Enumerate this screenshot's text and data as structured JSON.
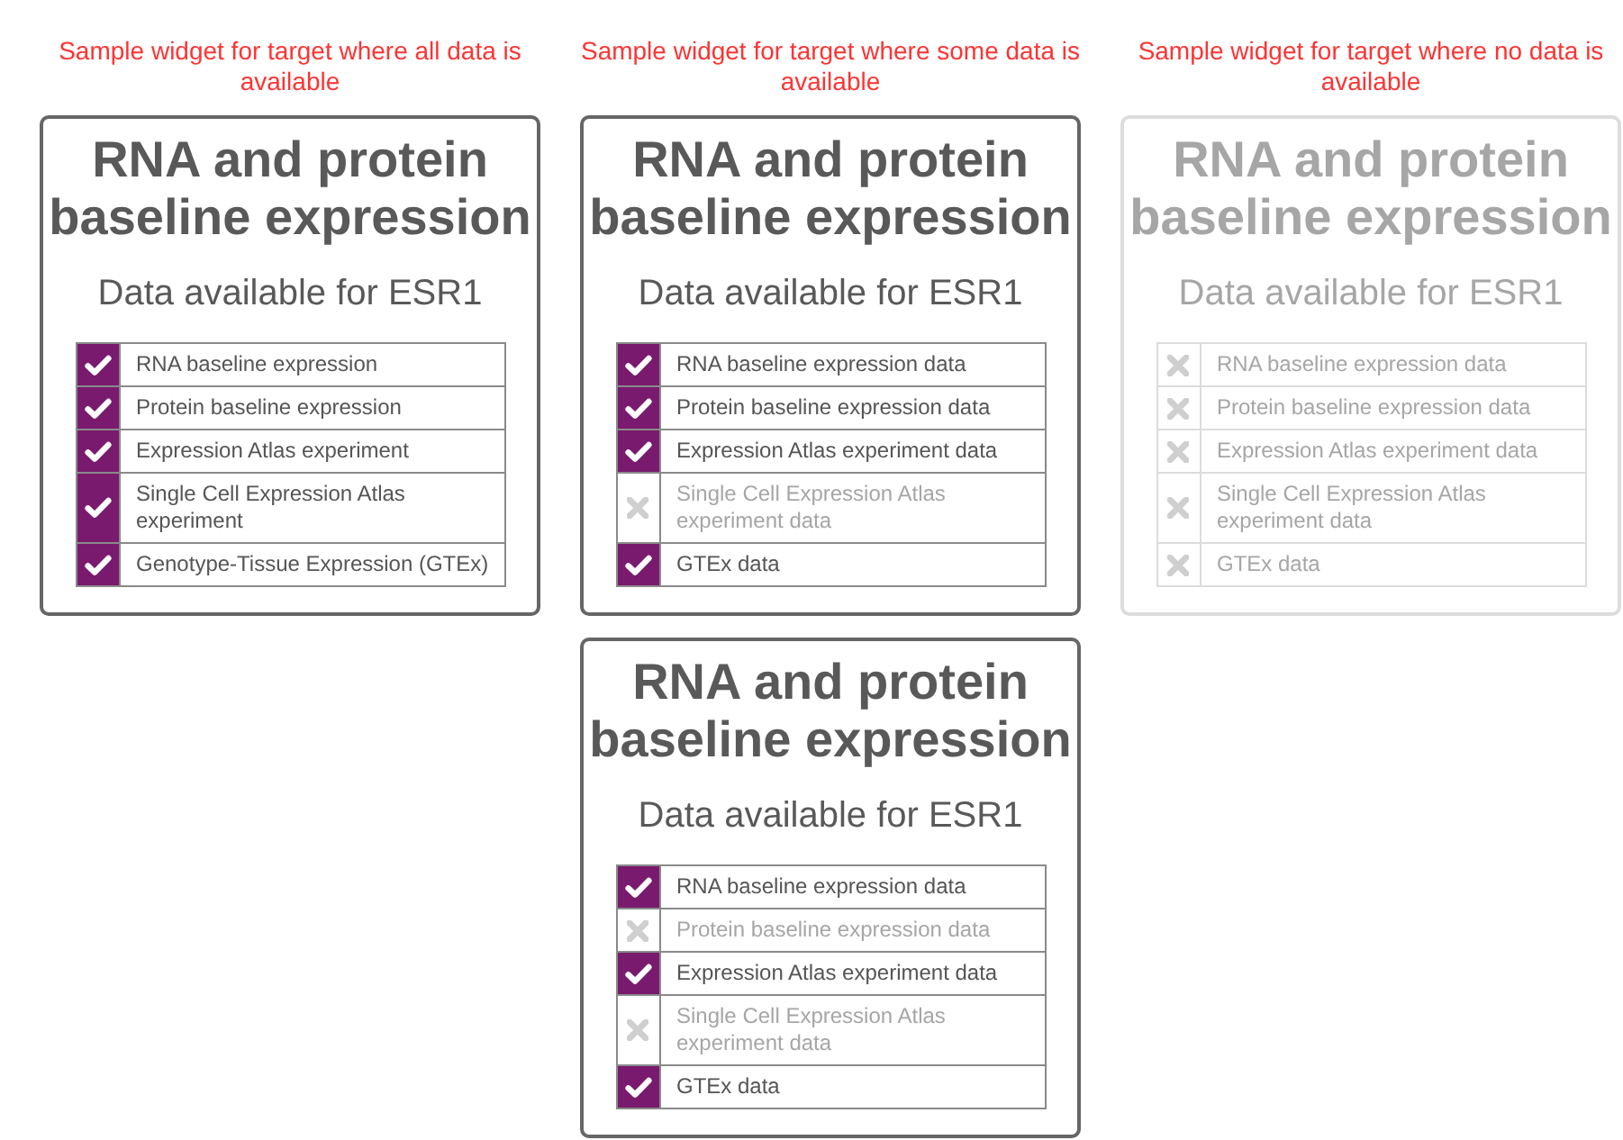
{
  "widgets": [
    {
      "caption": "Sample widget for target where all data is available",
      "available": true,
      "title": "RNA and protein baseline expression",
      "subtitle": "Data available for ESR1",
      "items": [
        {
          "label": "RNA baseline expression",
          "available": true
        },
        {
          "label": "Protein baseline expression",
          "available": true
        },
        {
          "label": "Expression Atlas experiment",
          "available": true
        },
        {
          "label": "Single Cell Expression Atlas experiment",
          "available": true
        },
        {
          "label": "Genotype-Tissue Expression (GTEx)",
          "available": true
        }
      ]
    },
    {
      "caption": "Sample widget for target where some data is available",
      "available": true,
      "title": "RNA and protein baseline expression",
      "subtitle": "Data available for ESR1",
      "items": [
        {
          "label": "RNA baseline expression data",
          "available": true
        },
        {
          "label": "Protein baseline expression data",
          "available": true
        },
        {
          "label": "Expression Atlas experiment data",
          "available": true
        },
        {
          "label": "Single Cell Expression Atlas experiment data",
          "available": false
        },
        {
          "label": "GTEx data",
          "available": true
        }
      ]
    },
    {
      "caption": "Sample widget for target where no data is available",
      "available": false,
      "title": "RNA and protein baseline expression",
      "subtitle": "Data available for ESR1",
      "items": [
        {
          "label": "RNA baseline expression data",
          "available": false
        },
        {
          "label": "Protein baseline expression data",
          "available": false
        },
        {
          "label": "Expression Atlas experiment data",
          "available": false
        },
        {
          "label": "Single Cell Expression Atlas experiment data",
          "available": false
        },
        {
          "label": "GTEx data",
          "available": false
        }
      ]
    },
    {
      "available": true,
      "title": "RNA and protein baseline expression",
      "subtitle": "Data available for ESR1",
      "items": [
        {
          "label": "RNA baseline expression data",
          "available": true
        },
        {
          "label": "Protein baseline expression data",
          "available": false
        },
        {
          "label": "Expression Atlas experiment data",
          "available": true
        },
        {
          "label": "Single Cell Expression Atlas experiment data",
          "available": false
        },
        {
          "label": "GTEx data",
          "available": true
        }
      ]
    }
  ]
}
